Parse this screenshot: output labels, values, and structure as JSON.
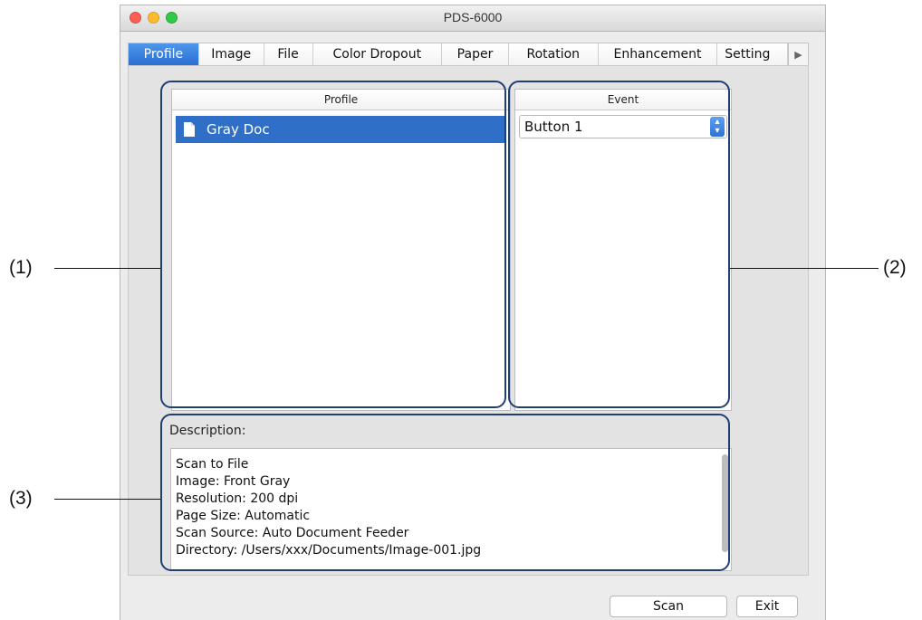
{
  "window": {
    "title": "PDS-6000"
  },
  "tabs": [
    {
      "label": "Profile",
      "active": true
    },
    {
      "label": "Image"
    },
    {
      "label": "File"
    },
    {
      "label": "Color Dropout"
    },
    {
      "label": "Paper"
    },
    {
      "label": "Rotation"
    },
    {
      "label": "Enhancement"
    },
    {
      "label": "Setting"
    }
  ],
  "tab_scroll_icon": "triangle-right-icon",
  "profile_table": {
    "header": "Profile",
    "rows": [
      {
        "label": "Gray Doc",
        "icon": "document-icon",
        "selected": true
      }
    ]
  },
  "event_table": {
    "header": "Event",
    "selected_value": "Button 1"
  },
  "description": {
    "label": "Description:",
    "lines": [
      "Scan to File",
      "Image: Front Gray",
      "Resolution: 200 dpi",
      "Page Size: Automatic",
      "Scan Source: Auto Document Feeder",
      "Directory: /Users/xxx/Documents/Image-001.jpg"
    ]
  },
  "buttons": {
    "scan": "Scan",
    "exit": "Exit"
  },
  "callouts": {
    "c1": "(1)",
    "c2": "(2)",
    "c3": "(3)"
  },
  "colors": {
    "selection": "#2f6fc7",
    "active_tab": "#3a82e0",
    "highlight_border": "#1f3f72"
  }
}
